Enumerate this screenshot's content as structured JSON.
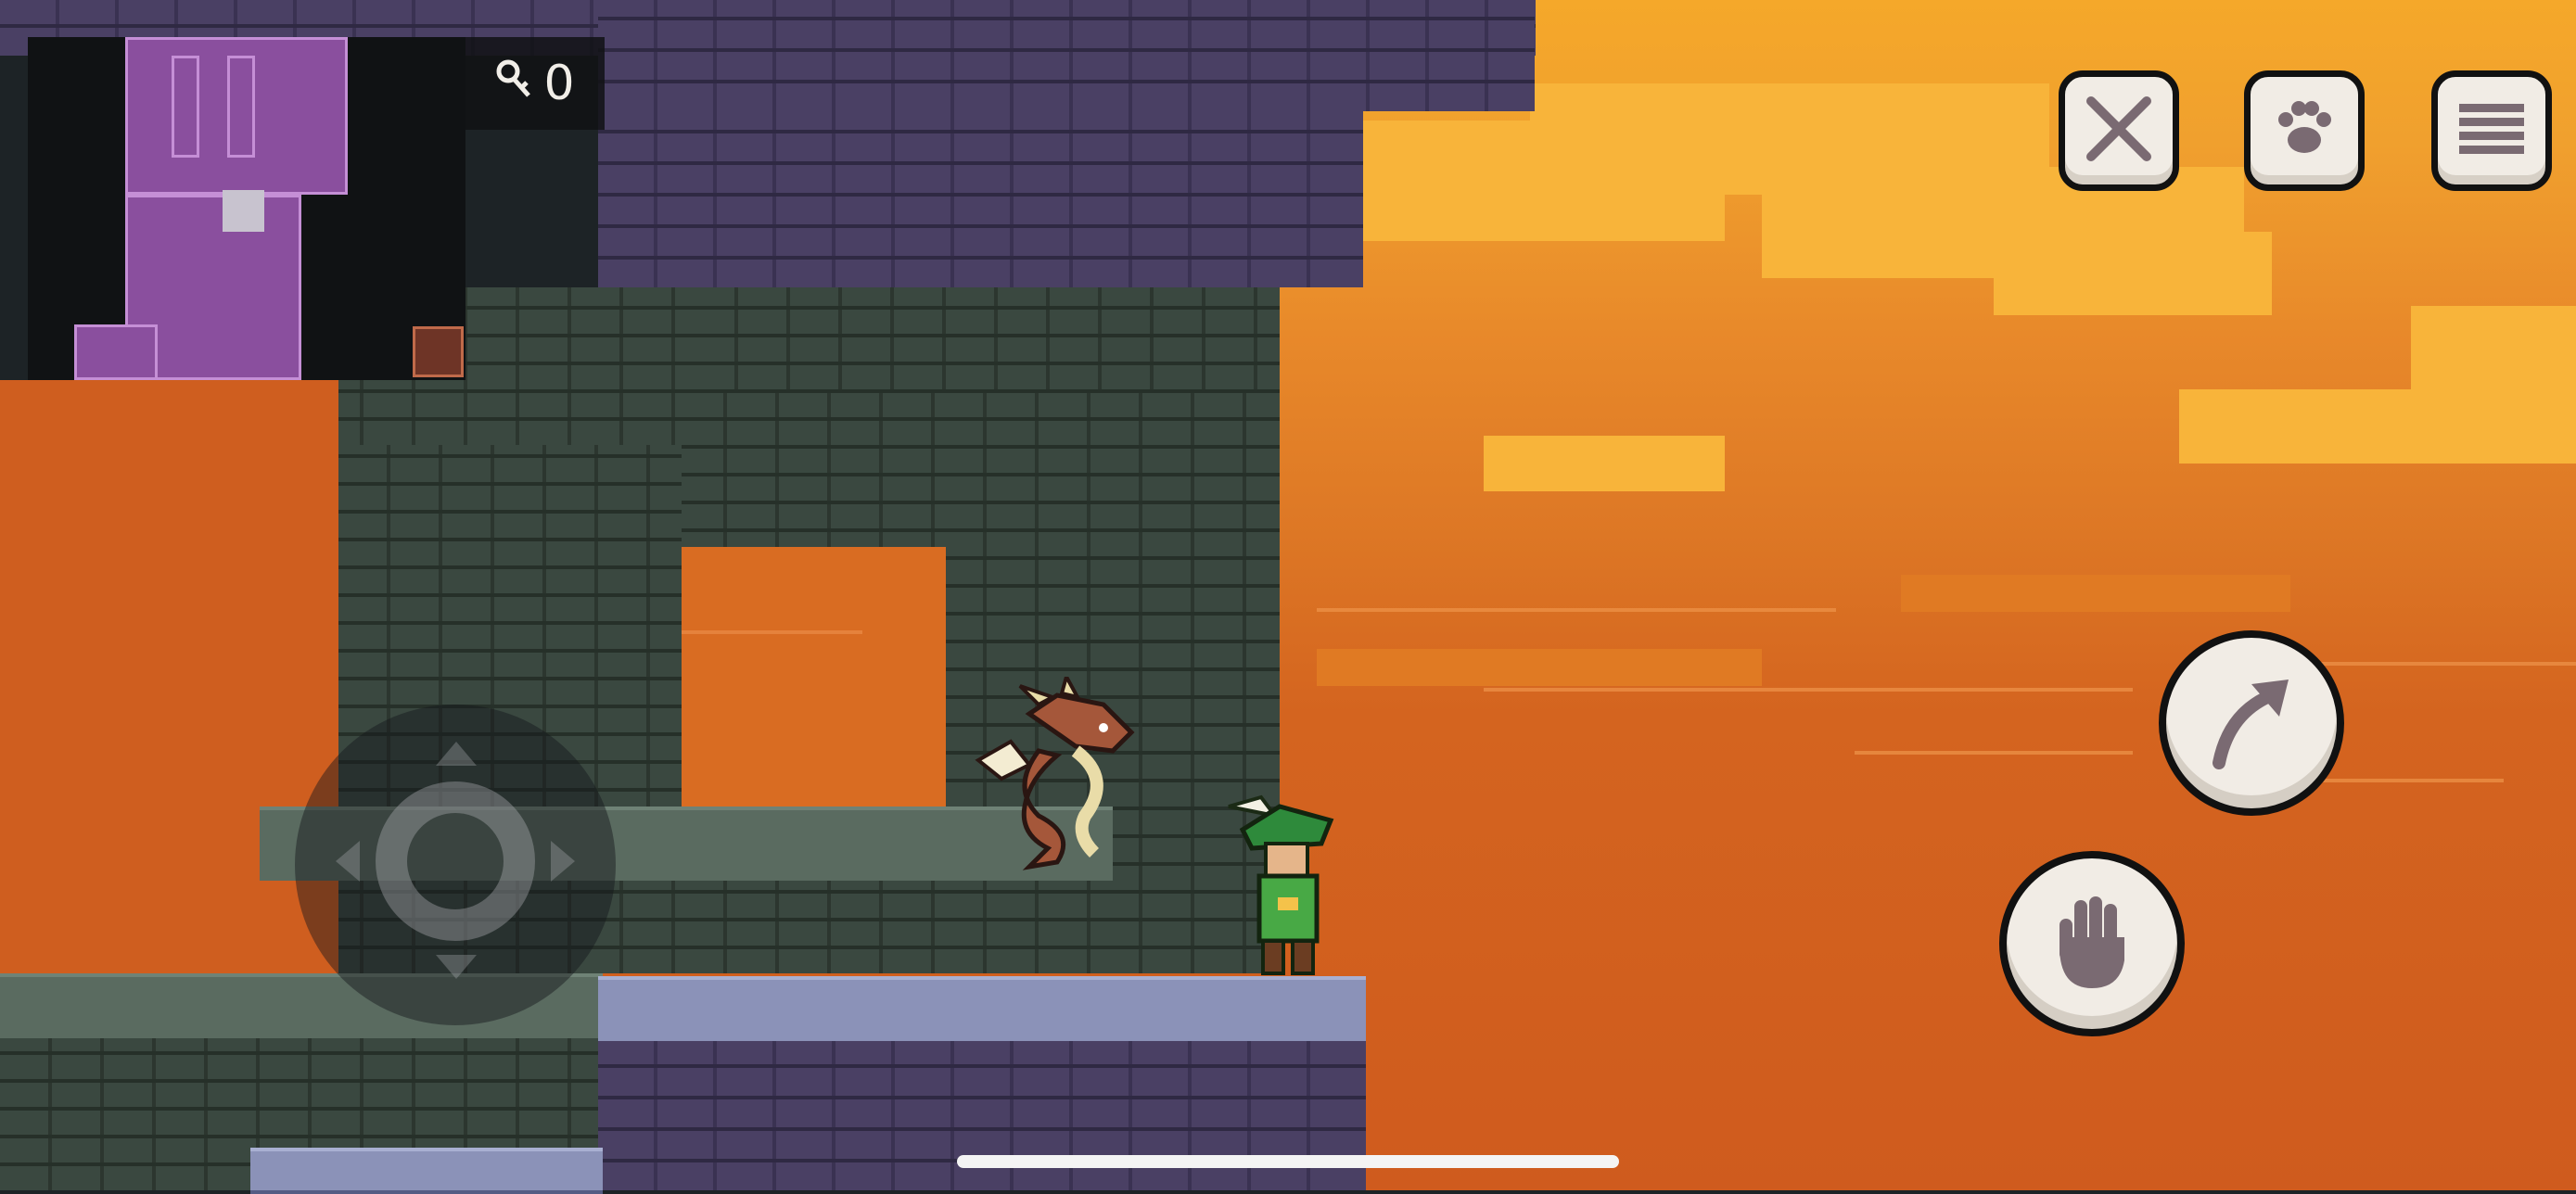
{
  "hud": {
    "key_count": "0",
    "key_icon": "key-icon",
    "buttons": {
      "weapons": "crossed-swords-icon",
      "pet": "paw-icon",
      "menu": "hamburger-menu-icon",
      "jump": "jump-arrow-icon",
      "interact": "hand-icon"
    }
  },
  "colors": {
    "sky_top": "#f5a82a",
    "sky_bottom": "#cf5b1e",
    "stone_purple": "#4a4064",
    "stone_green": "#3a4840",
    "minimap_room": "#8a4f9e",
    "button_fill": "#f1ece5"
  },
  "characters": {
    "player": "green-hat-adventurer",
    "enemy": "dragon-familiar"
  }
}
